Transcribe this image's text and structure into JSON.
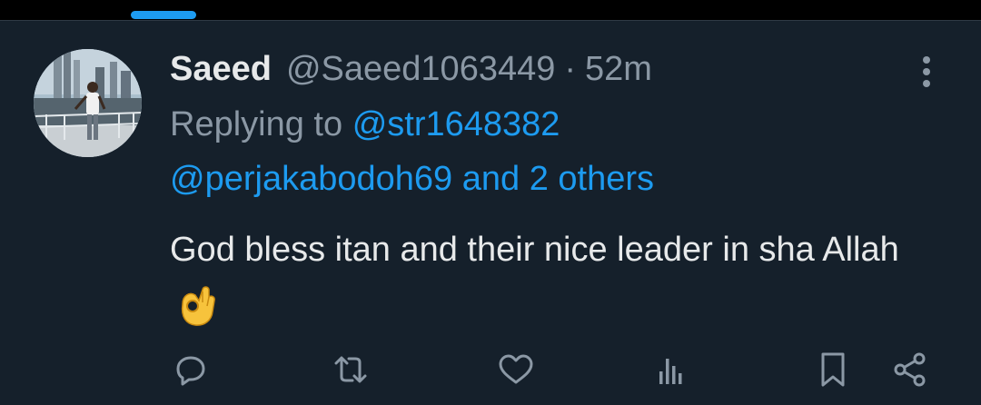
{
  "tweet": {
    "author_name": "Saeed",
    "handle": "@Saeed1063449",
    "separator": "·",
    "time": "52m",
    "replying_to_label": "Replying to",
    "reply_mention_1": "@str1648382",
    "reply_mention_2": "@perjakabodoh69",
    "reply_and": "and",
    "reply_others": "2 others",
    "text": "God bless itan and their nice leader in sha Allah",
    "emoji": "ok-hand"
  },
  "icons": {
    "more": "more-vertical-icon",
    "reply": "reply-icon",
    "retweet": "retweet-icon",
    "like": "like-icon",
    "views": "views-icon",
    "bookmark": "bookmark-icon",
    "share": "share-icon"
  },
  "colors": {
    "background": "#15202b",
    "text_primary": "#e7e9ea",
    "text_secondary": "#8b98a5",
    "accent": "#1d9bf0"
  }
}
